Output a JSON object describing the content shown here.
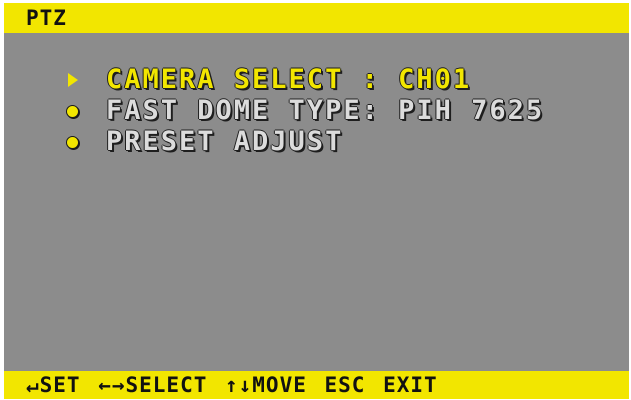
{
  "header": {
    "title": "PTZ"
  },
  "menu": {
    "items": [
      {
        "label": "CAMERA SELECT : CH01",
        "marker": "triangle-right-icon",
        "selected": true
      },
      {
        "label": "FAST DOME TYPE: PIH 7625",
        "marker": "dot-icon",
        "selected": false
      },
      {
        "label": "PRESET ADJUST",
        "marker": "dot-icon",
        "selected": false
      }
    ]
  },
  "footer": {
    "help_text": "↵SET ←→SELECT ↑↓MOVE ESC EXIT"
  },
  "colors": {
    "accent": "#f2e600",
    "background": "#8c8c8c",
    "text_normal": "#dcdcdc",
    "text_dark": "#111111"
  }
}
